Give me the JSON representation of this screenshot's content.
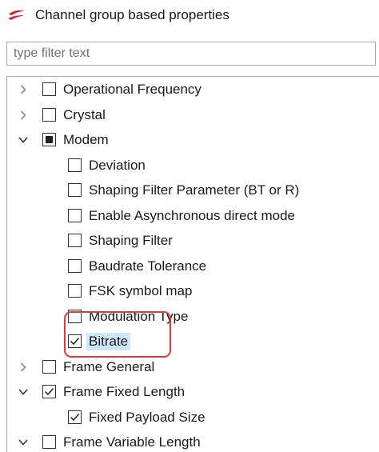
{
  "header": {
    "title": "Channel group based properties",
    "logo_icon": "silabs-logo-icon",
    "logo_color": "#d9232e"
  },
  "filter": {
    "placeholder": "type filter text",
    "value": ""
  },
  "tree": {
    "items": [
      {
        "label": "Operational Frequency",
        "expander": "collapsed",
        "check": "unchecked"
      },
      {
        "label": "Crystal",
        "expander": "collapsed",
        "check": "unchecked"
      },
      {
        "label": "Modem",
        "expander": "expanded",
        "check": "partial"
      },
      {
        "label": "Deviation",
        "expander": "none",
        "check": "unchecked"
      },
      {
        "label": "Shaping Filter Parameter (BT or R)",
        "expander": "none",
        "check": "unchecked"
      },
      {
        "label": "Enable Asynchronous direct mode",
        "expander": "none",
        "check": "unchecked"
      },
      {
        "label": "Shaping Filter",
        "expander": "none",
        "check": "unchecked"
      },
      {
        "label": "Baudrate Tolerance",
        "expander": "none",
        "check": "unchecked"
      },
      {
        "label": "FSK symbol map",
        "expander": "none",
        "check": "unchecked"
      },
      {
        "label": "Modulation Type",
        "expander": "none",
        "check": "unchecked"
      },
      {
        "label": "Bitrate",
        "expander": "none",
        "check": "checked",
        "selected": true
      },
      {
        "label": "Frame General",
        "expander": "collapsed",
        "check": "unchecked"
      },
      {
        "label": "Frame Fixed Length",
        "expander": "expanded",
        "check": "checked"
      },
      {
        "label": "Fixed Payload Size",
        "expander": "none",
        "check": "checked"
      },
      {
        "label": "Frame Variable Length",
        "expander": "expanded",
        "check": "unchecked"
      }
    ]
  },
  "annotation": {
    "color": "#e53935"
  }
}
